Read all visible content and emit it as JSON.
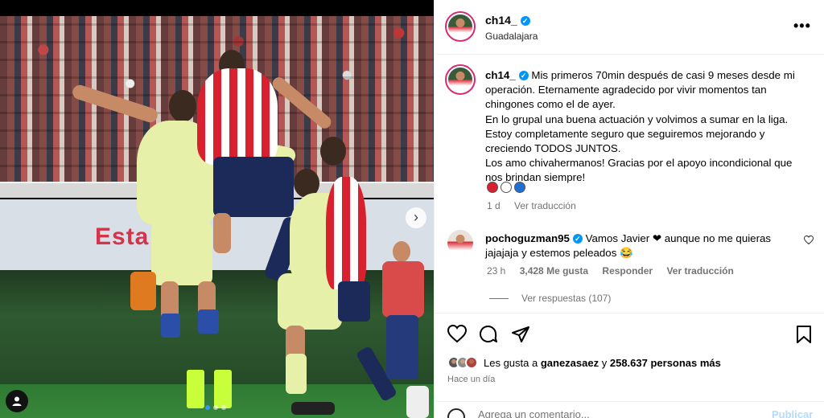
{
  "post": {
    "username": "ch14_",
    "location": "Guadalajara",
    "verified": true,
    "photo": {
      "ad_text_1": "Esta",
      "ad_text_2": "",
      "carousel_index": 1,
      "carousel_count": 3
    },
    "caption": {
      "username": "ch14_",
      "lines": [
        "Mis primeros 70min después de casi 9 meses desde mi",
        "operación. Eternamente agradecido por vivir momentos tan",
        "chingones como el de ayer.",
        "En lo grupal una buena actuación y volvimos a sumar en la liga.",
        "Estoy completamente seguro que seguiremos mejorando y",
        "creciendo TODOS JUNTOS.",
        "Los amo chivahermanos! Gracias por el apoyo incondicional que",
        "nos brindan siempre!"
      ],
      "emoji_colors": [
        "#d8202e",
        "#ffffff",
        "#1e6fd0"
      ],
      "age": "1 d",
      "see_translation": "Ver traducción"
    },
    "comment": {
      "username": "pochoguzman95",
      "verified": true,
      "text_line_1": "Vamos Javier ❤ aunque no me quieras",
      "text_line_2": "jajajaja y estemos peleados 😂",
      "age": "23 h",
      "likes": "3,428 Me gusta",
      "reply": "Responder",
      "see_translation": "Ver traducción",
      "view_replies": "Ver respuestas (107)"
    },
    "likes": {
      "prefix": "Les gusta a",
      "liked_by": "ganezasaez",
      "connector": "y",
      "others": "258.637 personas más"
    },
    "time_ago": "Hace un día",
    "add_comment_placeholder": "Agrega un comentario...",
    "publish": "Publicar"
  },
  "icons": {
    "more": "more-options-icon",
    "like": "heart-icon",
    "comment": "comment-icon",
    "share": "share-icon",
    "save": "bookmark-icon",
    "user_tag": "user-tag-icon",
    "emoji": "emoji-icon",
    "carousel_next": "chevron-right-icon"
  },
  "colors": {
    "accent": "#0095f6",
    "muted": "#737373",
    "publish_disabled": "#b3dbff"
  }
}
